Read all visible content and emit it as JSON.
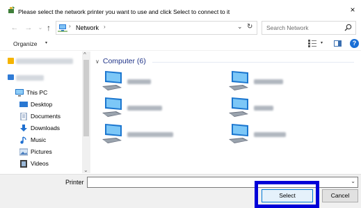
{
  "window": {
    "title": "Please select the network printer you want to use and click Select to connect to it",
    "close_glyph": "×"
  },
  "address": {
    "back_glyph": "←",
    "forward_glyph": "→",
    "recent_glyph": "⌄",
    "up_glyph": "↑",
    "breadcrumb": "Network",
    "separator": "›",
    "dropdown_glyph": "⌄",
    "refresh_glyph": "↻",
    "search_placeholder": "Search Network"
  },
  "toolbar": {
    "organize_label": "Organize",
    "organize_dropdown": "▾",
    "view_dropdown": "▾",
    "help_glyph": "?"
  },
  "navigation": {
    "this_pc": "This PC",
    "items": [
      {
        "label": "Desktop",
        "icon": "desktop-icon"
      },
      {
        "label": "Documents",
        "icon": "documents-icon"
      },
      {
        "label": "Downloads",
        "icon": "downloads-icon"
      },
      {
        "label": "Music",
        "icon": "music-icon"
      },
      {
        "label": "Pictures",
        "icon": "pictures-icon"
      },
      {
        "label": "Videos",
        "icon": "videos-icon"
      }
    ],
    "scroll_up": "^",
    "scroll_down": "⌄"
  },
  "content": {
    "group_chevron": "∨",
    "group_label": "Computer (6)",
    "devices_count": 6,
    "device_icon": "computer-icon"
  },
  "bottom": {
    "printer_label": "Printer",
    "printer_value": "",
    "dropdown_glyph": "⌄",
    "select_label": "Select",
    "cancel_label": "Cancel"
  },
  "colors": {
    "highlight_border": "#0000d8",
    "group_header": "#1e3287",
    "accent": "#1a6fd6"
  }
}
